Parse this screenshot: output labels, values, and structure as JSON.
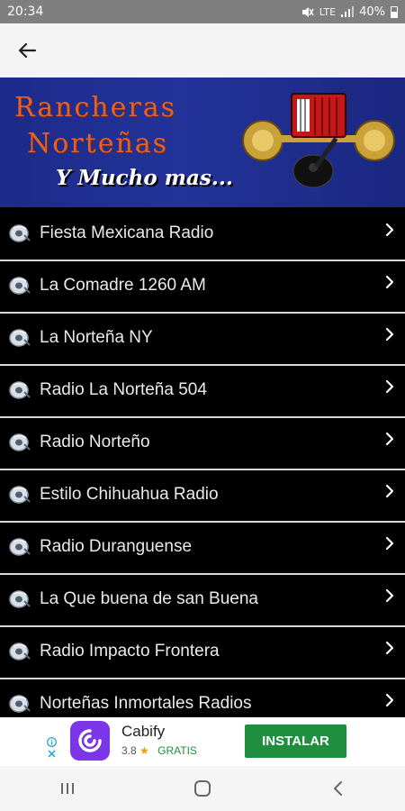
{
  "status_bar": {
    "time": "20:34",
    "signal_label": "LTE",
    "battery": "40%"
  },
  "app_bar": {
    "back_icon": "arrow-left-icon"
  },
  "banner": {
    "line1": "Rancheras",
    "line2": "Norteñas",
    "line3": "Y Mucho mas..."
  },
  "stations": [
    {
      "label": "Fiesta Mexicana Radio"
    },
    {
      "label": "La Comadre 1260 AM"
    },
    {
      "label": "La Norteña NY"
    },
    {
      "label": "Radio La Norteña 504"
    },
    {
      "label": "Radio Norteño"
    },
    {
      "label": "Estilo Chihuahua Radio"
    },
    {
      "label": "Radio Duranguense"
    },
    {
      "label": "La Que buena de san Buena"
    },
    {
      "label": "Radio Impacto Frontera"
    },
    {
      "label": "Norteñas Inmortales Radios"
    }
  ],
  "ad": {
    "app_name": "Cabify",
    "rating": "3.8",
    "price": "GRATIS",
    "install_label": "INSTALAR",
    "brand_color": "#7b36e8",
    "button_color": "#1f8f3f"
  },
  "nav": {
    "recents_icon": "recents-icon",
    "home_icon": "home-icon",
    "back_icon": "back-chevron-icon"
  }
}
